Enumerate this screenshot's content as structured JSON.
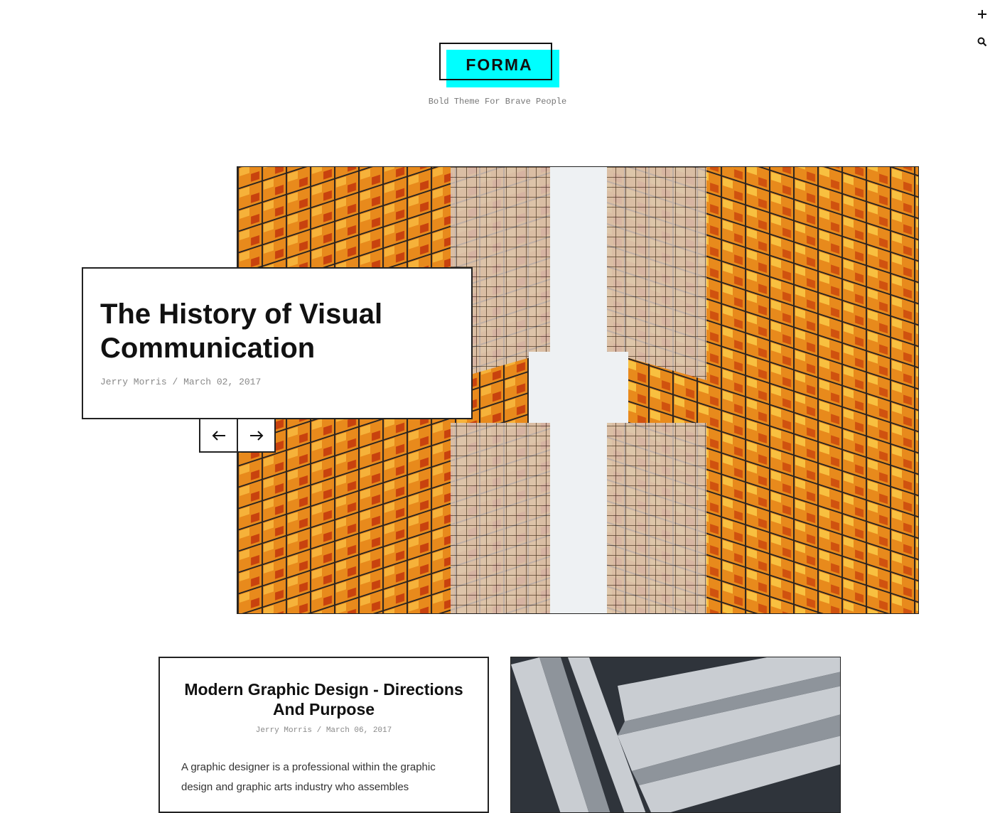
{
  "header": {
    "logo": "FORMA",
    "tagline": "Bold Theme For Brave People",
    "accent_color": "#00ffff"
  },
  "top_icons": [
    "plus-icon",
    "search-icon"
  ],
  "hero": {
    "title": "The History of Visual Communication",
    "author": "Jerry Morris",
    "separator": "/",
    "date": "March 02, 2017",
    "image": "looking-up-between-glass-skyscrapers-orange-windows"
  },
  "slider_nav": {
    "prev_icon": "arrow-left-icon",
    "next_icon": "arrow-right-icon"
  },
  "posts": [
    {
      "title": "Modern Graphic Design - Directions And Purpose",
      "author": "Jerry Morris",
      "separator": "/",
      "date": "March 06, 2017",
      "excerpt": "A graphic designer is a professional within the graphic design and graphic arts industry who assembles"
    }
  ],
  "post_image": "abstract-diagonal-metal-building-facade"
}
